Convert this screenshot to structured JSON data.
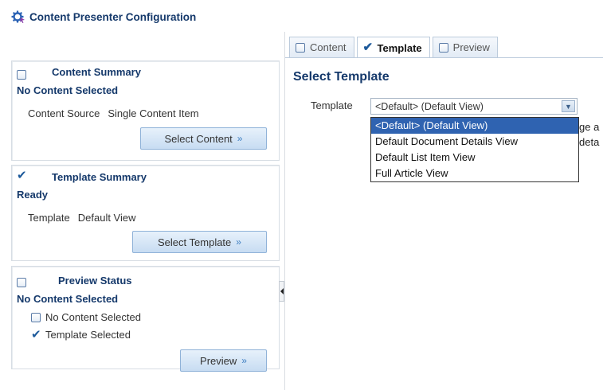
{
  "header": {
    "title": "Content Presenter Configuration",
    "icon": "gear-icon"
  },
  "panels": {
    "content": {
      "title": "Content Summary",
      "status": "No Content Selected",
      "source_label": "Content Source",
      "source_value": "Single Content Item",
      "button": "Select Content"
    },
    "template": {
      "title": "Template Summary",
      "status": "Ready",
      "template_label": "Template",
      "template_value": "Default View",
      "button": "Select Template"
    },
    "preview": {
      "title": "Preview Status",
      "status": "No Content Selected",
      "items": [
        "No Content Selected",
        "Template Selected"
      ],
      "button": "Preview"
    }
  },
  "tabs": [
    {
      "label": "Content",
      "state": "unchecked"
    },
    {
      "label": "Template",
      "state": "checked",
      "active": true
    },
    {
      "label": "Preview",
      "state": "unchecked"
    }
  ],
  "main": {
    "section_title": "Select Template",
    "template_label": "Template",
    "selected_value": "<Default> (Default View)",
    "options": [
      "<Default> (Default View)",
      "Default Document Details View",
      "Default List Item View",
      "Full Article View"
    ],
    "behind_line1": "ge a",
    "behind_line2": "deta"
  },
  "colors": {
    "heading": "#15396b",
    "accent": "#2f63b1",
    "button_bg": "#c7dcf2"
  }
}
